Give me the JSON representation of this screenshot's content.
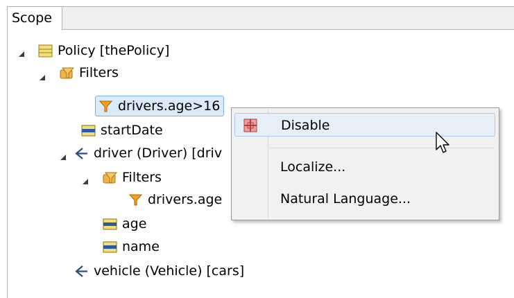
{
  "view": {
    "tab_label": "Scope"
  },
  "tree": {
    "policy": "Policy [thePolicy]",
    "filters_1": "Filters",
    "filter_1": "drivers.age>16",
    "start_date": "startDate",
    "driver": "driver (Driver) [driv",
    "filters_2": "Filters",
    "filter_2": "drivers.age",
    "age": "age",
    "name": "name",
    "vehicle": "vehicle (Vehicle) [cars]"
  },
  "context_menu": {
    "disable": "Disable",
    "localize": "Localize...",
    "natural_language": "Natural Language..."
  },
  "icons": {
    "entity": "entity-icon",
    "filters": "filters-folder-icon",
    "filter": "funnel-icon",
    "attribute": "attribute-icon",
    "association": "association-arrow-icon",
    "disable": "disable-filter-icon"
  }
}
